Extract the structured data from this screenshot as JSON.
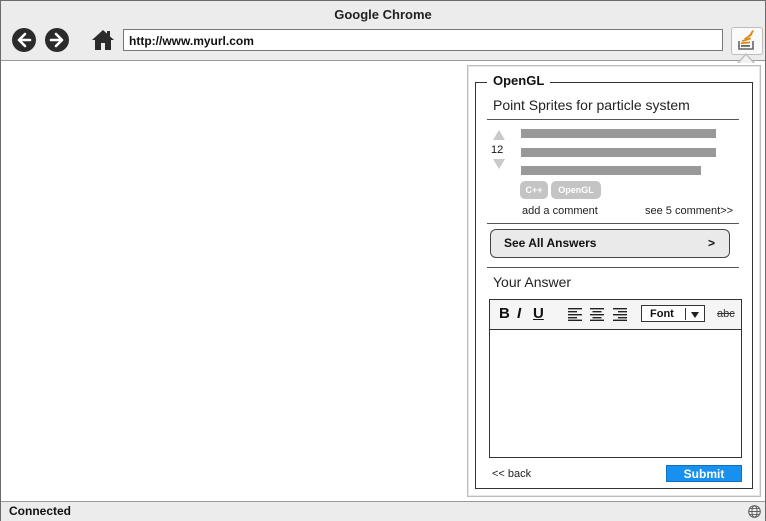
{
  "window": {
    "title": "Google Chrome"
  },
  "toolbar": {
    "url": "http://www.myurl.com"
  },
  "panel": {
    "legend": "OpenGL",
    "question_title": "Point Sprites for particle system",
    "vote_count": "12",
    "tags": [
      "C++",
      "OpenGL"
    ],
    "add_comment": "add a comment",
    "see_comments": "see 5 comment>>",
    "see_all_answers": "See All Answers",
    "see_all_chevron": ">",
    "your_answer": "Your Answer",
    "editor": {
      "bold": "B",
      "italic": "I",
      "underline": "U",
      "font_select": "Font",
      "strikethrough": "abc"
    },
    "back": "<< back",
    "submit": "Submit"
  },
  "status": {
    "text": "Connected"
  }
}
